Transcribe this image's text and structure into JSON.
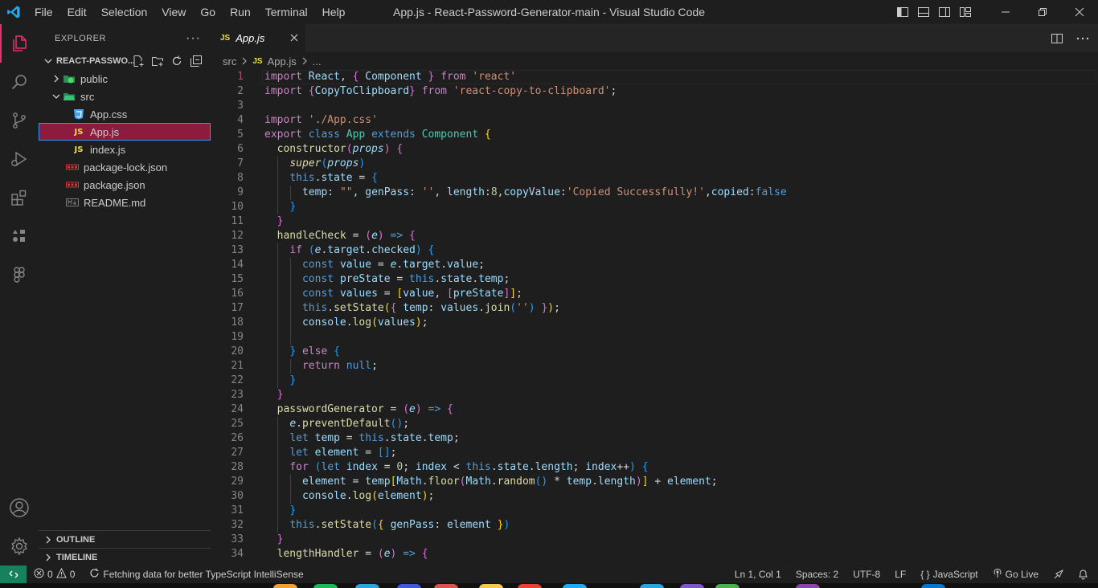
{
  "window": {
    "title": "App.js - React-Password-Generator-main - Visual Studio Code",
    "menu": [
      "File",
      "Edit",
      "Selection",
      "View",
      "Go",
      "Run",
      "Terminal",
      "Help"
    ]
  },
  "activitybar": {
    "items": [
      "explorer-icon",
      "search-icon",
      "source-control-icon",
      "run-debug-icon",
      "extensions-icon",
      "remote-icon",
      "figma-icon"
    ],
    "bottom": [
      "accounts-icon",
      "manage-gear-icon"
    ],
    "accent": "#e3336b"
  },
  "sidebar": {
    "title": "EXPLORER",
    "more": "···",
    "project": "REACT-PASSWO...",
    "tree": [
      {
        "label": "public",
        "type": "folder"
      },
      {
        "label": "src",
        "type": "folder"
      },
      {
        "label": "App.css",
        "type": "css"
      },
      {
        "label": "App.js",
        "type": "js"
      },
      {
        "label": "index.js",
        "type": "js"
      },
      {
        "label": "package-lock.json",
        "type": "npm"
      },
      {
        "label": "package.json",
        "type": "npm"
      },
      {
        "label": "README.md",
        "type": "md"
      }
    ],
    "outline": "OUTLINE",
    "timeline": "TIMELINE"
  },
  "tabs": {
    "active": {
      "label": "App.js",
      "icon": "JS"
    }
  },
  "breadcrumb": {
    "parts": [
      "src",
      "App.js",
      "..."
    ]
  },
  "editor": {
    "current_line": 1,
    "line_numbers": [
      "1",
      "2",
      "3",
      "4",
      "5",
      "6",
      "7",
      "8",
      "9",
      "10",
      "11",
      "12",
      "13",
      "14",
      "15",
      "16",
      "17",
      "18",
      "19",
      "20",
      "21",
      "22",
      "23",
      "24",
      "25",
      "26",
      "27",
      "28",
      "29",
      "30",
      "31",
      "32",
      "33",
      "34"
    ]
  },
  "statusbar": {
    "errors": "0",
    "warnings": "0",
    "message": "Fetching data for better TypeScript IntelliSense",
    "position": "Ln 1, Col 1",
    "spaces": "Spaces: 2",
    "encoding": "UTF-8",
    "eol": "LF",
    "language_brackets": "{ }",
    "language": "JavaScript",
    "golive": "Go Live"
  }
}
